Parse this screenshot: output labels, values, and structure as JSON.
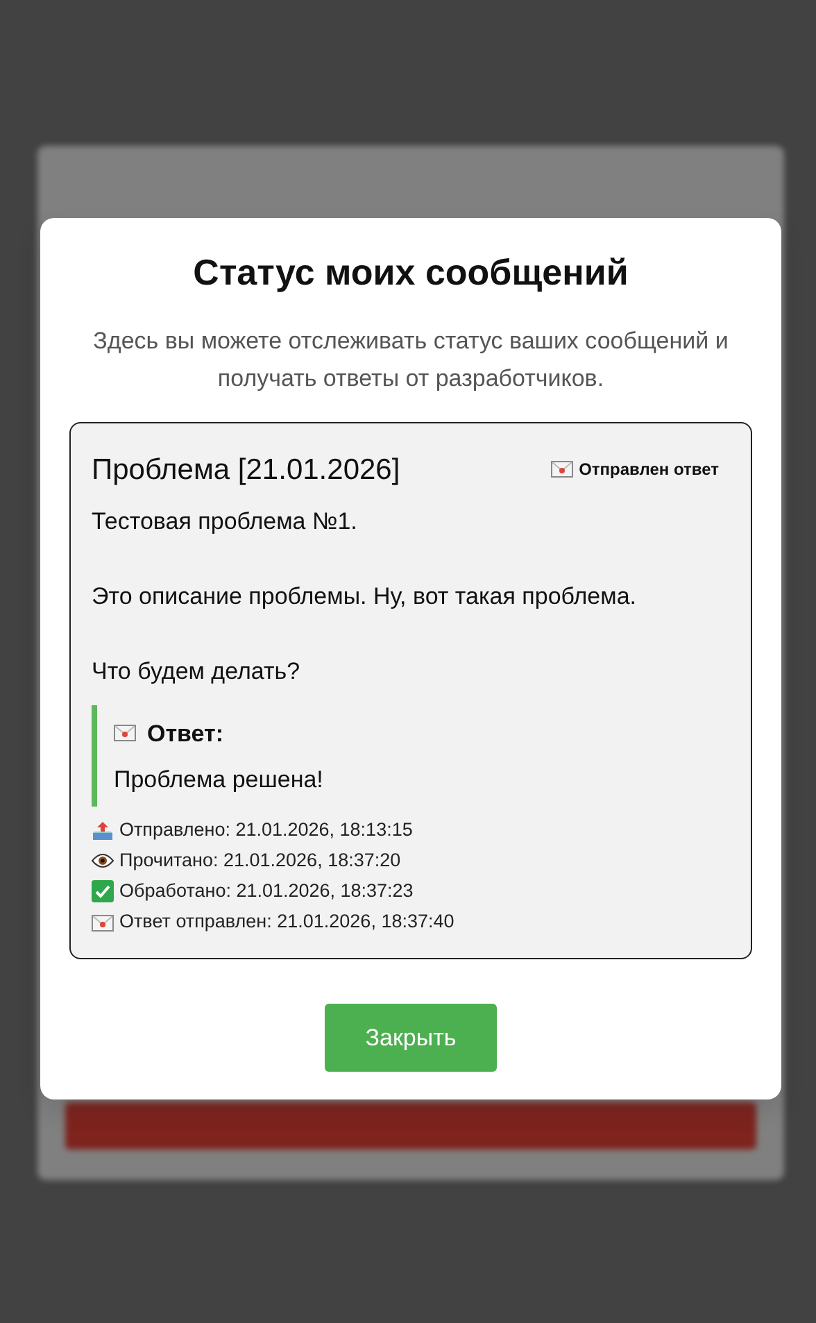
{
  "modal": {
    "title": "Статус моих сообщений",
    "description": "Здесь вы можете отслеживать статус ваших сообщений и получать ответы от разработчиков.",
    "message": {
      "title": "Проблема [21.01.2026]",
      "status": {
        "kind": "answered",
        "label": "Отправлен ответ"
      },
      "paragraphs": [
        "Тестовая проблема №1.",
        "Это описание проблемы. Ну, вот такая проблема.",
        "Что будем делать?"
      ],
      "answer": {
        "label": "Ответ:",
        "text": "Проблема решена!"
      },
      "history": [
        {
          "kind": "sent",
          "text": "Отправлено: 21.01.2026, 18:13:15"
        },
        {
          "kind": "read",
          "text": "Прочитано: 21.01.2026, 18:37:20"
        },
        {
          "kind": "processed",
          "text": "Обработано: 21.01.2026, 18:37:23"
        },
        {
          "kind": "answered",
          "text": "Ответ отправлен: 21.01.2026, 18:37:40"
        }
      ]
    },
    "close_button": "Закрыть"
  }
}
